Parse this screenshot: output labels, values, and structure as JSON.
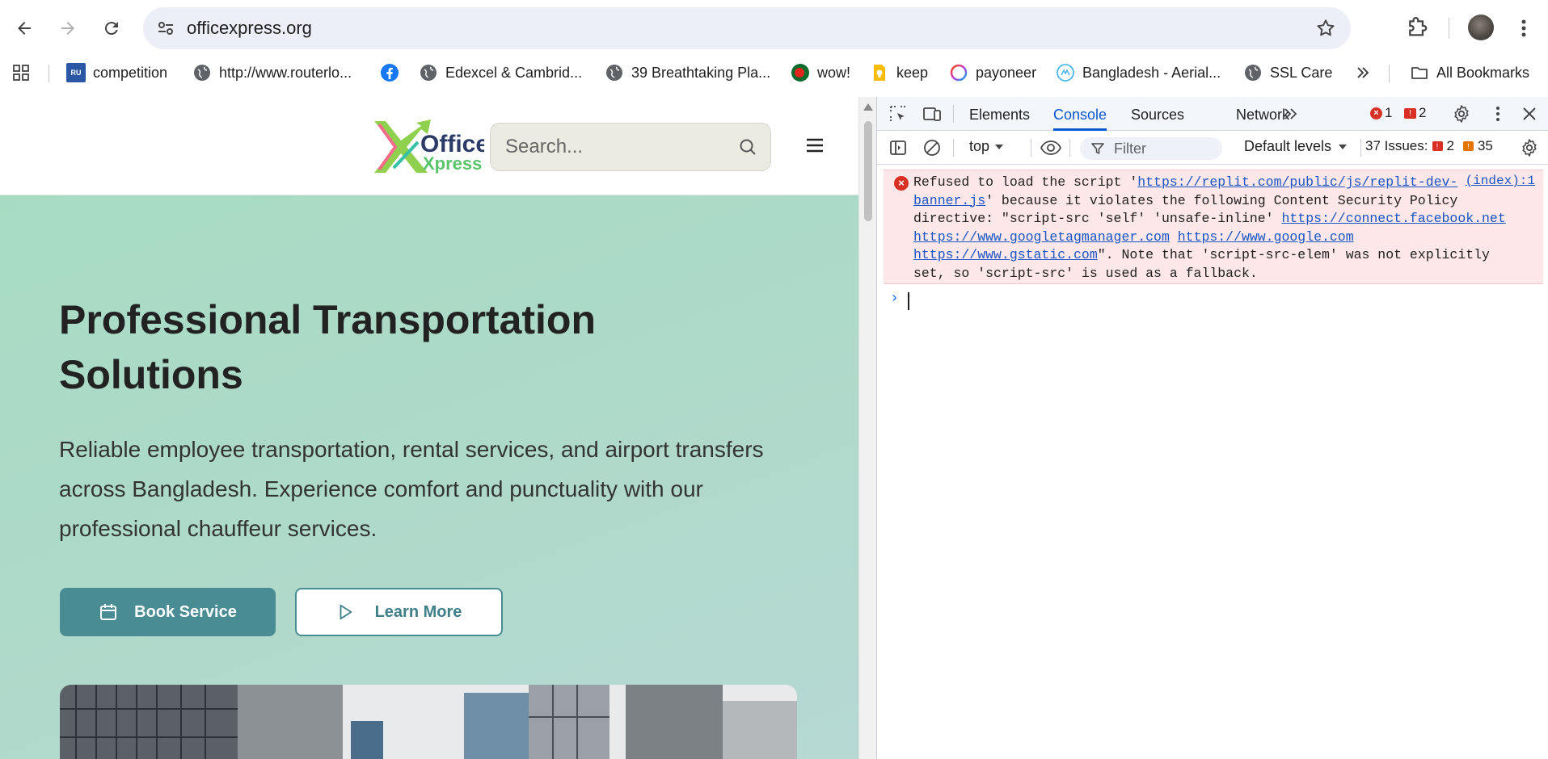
{
  "browser": {
    "url": "officexpress.org",
    "bookmarks": [
      {
        "label": "competition",
        "icon": "ru-favicon"
      },
      {
        "label": "http://www.routerlo...",
        "icon": "globe-icon"
      },
      {
        "label": "",
        "icon": "facebook-icon"
      },
      {
        "label": "Edexcel & Cambrid...",
        "icon": "globe-icon"
      },
      {
        "label": "39 Breathtaking Pla...",
        "icon": "globe-icon"
      },
      {
        "label": "wow!",
        "icon": "bangladesh-flag-icon"
      },
      {
        "label": "keep",
        "icon": "keep-icon"
      },
      {
        "label": "payoneer",
        "icon": "payoneer-icon"
      },
      {
        "label": "Bangladesh - Aerial...",
        "icon": "aerial-icon"
      },
      {
        "label": "SSL Care",
        "icon": "globe-icon"
      }
    ],
    "all_bookmarks_label": "All Bookmarks"
  },
  "site": {
    "logo_text_top": "Office",
    "logo_text_bottom": "Xpress",
    "search_placeholder": "Search...",
    "hero_title": "Professional Transportation Solutions",
    "hero_description": "Reliable employee transportation, rental services, and airport transfers across Bangladesh. Experience comfort and punctuality with our professional chauffeur services.",
    "book_button": "Book Service",
    "learn_button": "Learn More"
  },
  "devtools": {
    "tabs": [
      "Elements",
      "Console",
      "Sources",
      "Network"
    ],
    "active_tab": "Console",
    "error_count": "1",
    "warning_count": "2",
    "context": "top",
    "filter_placeholder": "Filter",
    "levels": "Default levels",
    "issues_label": "37 Issues:",
    "issues_errors": "2",
    "issues_warnings": "35",
    "console_error": {
      "part1": "Refused to load the script '",
      "link1": "https://replit.com/public/js/replit-dev-banner.js",
      "part2": "' because it violates the following Content Security Policy directive: \"script-src 'self' 'unsafe-inline' ",
      "link2": "https://connect.facebook.net",
      "link3": "https://www.googletagmanager.com",
      "link4": "https://www.google.com",
      "link5": "https://www.gstatic.com",
      "part3": "\". Note that 'script-src-elem' was not explicitly set, so 'script-src' is used as a fallback.",
      "source": "(index):1"
    }
  }
}
